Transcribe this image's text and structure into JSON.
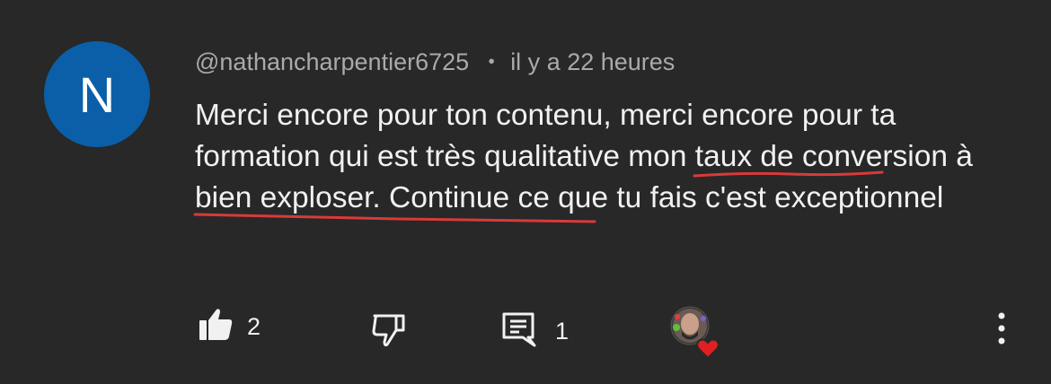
{
  "comment": {
    "avatar_letter": "N",
    "author": "@nathancharpentier6725",
    "separator": "•",
    "time": "il y a 22 heures",
    "text_part1": "Merci encore pour ton contenu, merci encore pour ta formation qui est très qualitative ",
    "text_highlight": "mon taux de conversion à bien exploser",
    "text_part2": ". Continue ce que tu fais c'est exceptionnel"
  },
  "actions": {
    "like_count": "2",
    "reply_count": "1"
  },
  "colors": {
    "background": "#282828",
    "avatar": "#0b5fa8",
    "underline": "#d93a3a",
    "heart": "#e02020"
  },
  "icons": [
    "like-icon",
    "dislike-icon",
    "reply-icon",
    "creator-heart-icon",
    "more-vert-icon"
  ]
}
